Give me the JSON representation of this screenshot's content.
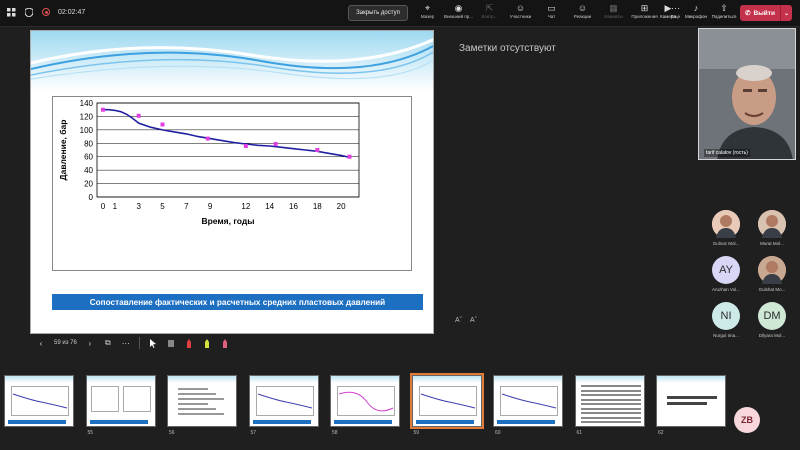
{
  "topbar": {
    "timer": "02:02:47",
    "stop_share": "Закрыть доступ",
    "tools": [
      {
        "icon": "laser-icon",
        "glyph": "⌖",
        "label": "Мазер"
      },
      {
        "icon": "eye-icon",
        "glyph": "◉",
        "label": "Внешний пр..."
      },
      {
        "icon": "control-icon",
        "glyph": "⇱",
        "label": "Контр...",
        "dim": true
      },
      {
        "icon": "people-icon",
        "glyph": "☺",
        "label": "Участники"
      },
      {
        "icon": "chat-icon",
        "glyph": "▭",
        "label": "Чат"
      },
      {
        "icon": "reactions-icon",
        "glyph": "☺",
        "label": "Реакции"
      },
      {
        "icon": "rooms-icon",
        "glyph": "▦",
        "label": "Комнаты",
        "dim": true
      },
      {
        "icon": "apps-icon",
        "glyph": "⊞",
        "label": "Приложения"
      },
      {
        "icon": "more-icon",
        "glyph": "⋯",
        "label": "Еще"
      }
    ],
    "right_tools": [
      {
        "icon": "camera-icon",
        "glyph": "▶",
        "label": "Камера"
      },
      {
        "icon": "mic-icon",
        "glyph": "♪",
        "label": "Микрофон"
      },
      {
        "icon": "share-icon",
        "glyph": "⇧",
        "label": "Поделиться"
      }
    ],
    "leave_label": "Выйти"
  },
  "slide": {
    "caption": "Сопоставление фактических и расчетных средних пластовых давлений"
  },
  "chart_data": {
    "type": "line",
    "title": "",
    "xlabel": "Время, годы",
    "ylabel": "Давление, бар",
    "xlim": [
      -0.5,
      21.5
    ],
    "ylim": [
      0,
      140
    ],
    "xticks": [
      0,
      1,
      3,
      5,
      7,
      9,
      12,
      14,
      16,
      18,
      20
    ],
    "yticks": [
      0,
      20,
      40,
      60,
      80,
      100,
      120,
      140
    ],
    "grid": true,
    "series": [
      {
        "kind": "line",
        "color": "#2020a0",
        "x": [
          0,
          0.5,
          1,
          1.5,
          2,
          2.5,
          3,
          4,
          5,
          6,
          7,
          8,
          9,
          10,
          11,
          12,
          13,
          14,
          15,
          16,
          17,
          18,
          19,
          20,
          20.7
        ],
        "y": [
          130,
          130,
          129,
          127,
          123,
          117,
          110,
          104,
          100,
          97,
          94,
          90,
          87,
          84,
          81,
          79,
          77,
          76,
          74,
          72,
          70,
          68,
          65,
          62,
          59
        ]
      },
      {
        "kind": "scatter",
        "color": "#e040e0",
        "x": [
          0,
          3,
          5,
          8.8,
          12,
          14.5,
          18,
          20.7
        ],
        "y": [
          130,
          121,
          108,
          87,
          76,
          79,
          70,
          60
        ]
      }
    ]
  },
  "notes": {
    "text": "Заметки отсутствуют",
    "font_small": "Aˇ",
    "font_large": "Aˆ"
  },
  "video": {
    "name": "tarif calalov (гость)"
  },
  "participants": [
    {
      "name": "Gulnaz Mol...",
      "initials": "",
      "color": "#e9c9b7",
      "photo": true
    },
    {
      "name": "Murat Mol...",
      "initials": "",
      "color": "#d9c2b0",
      "photo": true
    },
    {
      "name": "Aruzhan Vol...",
      "initials": "AY",
      "color": "#d8d6f5"
    },
    {
      "name": "Gulshat Mo...",
      "initials": "",
      "color": "#c8a890",
      "photo": true
    },
    {
      "name": "Nurgul Ima...",
      "initials": "NI",
      "color": "#cdeae8"
    },
    {
      "name": "Dilyara Mol...",
      "initials": "DM",
      "color": "#cfe8d6"
    }
  ],
  "slide_nav": {
    "counter": "59 из 76"
  },
  "thumbnails": [
    {
      "num": "",
      "kind": "chart"
    },
    {
      "num": "55",
      "kind": "table"
    },
    {
      "num": "56",
      "kind": "formula"
    },
    {
      "num": "57",
      "kind": "chart"
    },
    {
      "num": "58",
      "kind": "chart2"
    },
    {
      "num": "59",
      "kind": "chart",
      "selected": true
    },
    {
      "num": "60",
      "kind": "chart"
    },
    {
      "num": "61",
      "kind": "text"
    },
    {
      "num": "62",
      "kind": "text2"
    }
  ],
  "self_avatar": "ZB"
}
